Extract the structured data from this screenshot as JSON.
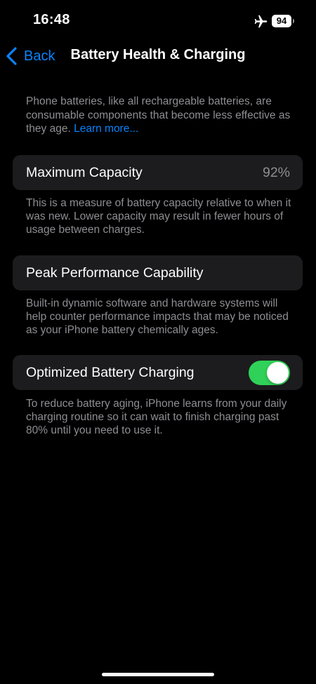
{
  "status_bar": {
    "time": "16:48",
    "battery_level": "94",
    "icons": [
      "airplane-icon",
      "battery-icon"
    ]
  },
  "nav": {
    "back_label": "Back",
    "title": "Battery Health & Charging",
    "back_icon": "chevron-left-icon"
  },
  "intro": {
    "text": "Phone batteries, like all rechargeable batteries, are consumable components that become less effective as they age. ",
    "link": "Learn more..."
  },
  "max_capacity": {
    "label": "Maximum Capacity",
    "value": "92%",
    "footnote": "This is a measure of battery capacity relative to when it was new. Lower capacity may result in fewer hours of usage between charges."
  },
  "peak_performance": {
    "label": "Peak Performance Capability",
    "footnote": "Built-in dynamic software and hardware systems will help counter performance impacts that may be noticed as your iPhone battery chemically ages."
  },
  "optimized_charging": {
    "label": "Optimized Battery Charging",
    "enabled": true,
    "footnote": "To reduce battery aging, iPhone learns from your daily charging routine so it can wait to finish charging past 80% until you need to use it."
  },
  "colors": {
    "background": "#000000",
    "cell": "#1c1c1e",
    "accent": "#0a84ff",
    "toggle_on": "#30d158",
    "secondary_text": "#8e8e93"
  }
}
